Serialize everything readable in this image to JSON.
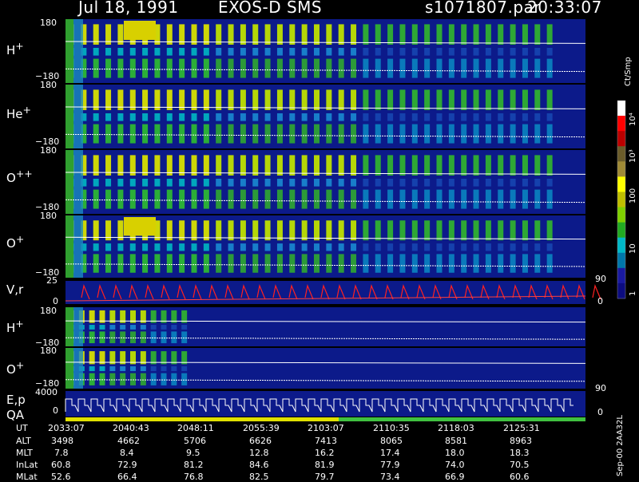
{
  "header": {
    "date": "Jul 18, 1991",
    "title": "EXOS-D SMS",
    "file": "s1071807.par",
    "time": "20:33:07"
  },
  "colorbar": {
    "unit": "Ct/Smp",
    "ticks": [
      "10⁴",
      "10³",
      "100",
      "10",
      "1"
    ],
    "stops": [
      "#ffffff",
      "#ff0000",
      "#bb0000",
      "#6b5c2a",
      "#a08a36",
      "#ffff00",
      "#bfbf00",
      "#7fd000",
      "#22aa22",
      "#00b8c8",
      "#0077aa",
      "#1a1aa0",
      "#0c0c80"
    ]
  },
  "chart_data": {
    "type": "heatmap",
    "panels": [
      {
        "id": "h",
        "label": "H",
        "sup": "+",
        "ymax": "180",
        "ymin": "−180"
      },
      {
        "id": "he",
        "label": "He",
        "sup": "+",
        "ymax": "180",
        "ymin": "−180"
      },
      {
        "id": "opp",
        "label": "O",
        "sup": "++",
        "ymax": "180",
        "ymin": "−180"
      },
      {
        "id": "o",
        "label": "O",
        "sup": "+",
        "ymax": "180",
        "ymin": "−180"
      },
      {
        "id": "vr",
        "label": "V,r",
        "ymax": "25",
        "ymin": "0",
        "right_max": "90",
        "right_min": "0"
      },
      {
        "id": "h2",
        "label": "H",
        "sup": "+",
        "ymax": "180",
        "ymin": "−180"
      },
      {
        "id": "o2",
        "label": "O",
        "sup": "+",
        "ymax": "180",
        "ymin": "−180"
      },
      {
        "id": "ep",
        "label": "E,p",
        "ymax": "4000",
        "ymin": "0",
        "right_max": "90",
        "right_min": "0"
      }
    ],
    "qa_label": "QA",
    "stamp": "Sep-00 2AA32L",
    "ephemeris": {
      "rows": [
        {
          "label": "UT",
          "values": [
            "2033:07",
            "2040:43",
            "2048:11",
            "2055:39",
            "2103:07",
            "2110:35",
            "2118:03",
            "2125:31"
          ]
        },
        {
          "label": "ALT",
          "values": [
            "3498",
            "4662",
            "5706",
            "6626",
            "7413",
            "8065",
            "8581",
            "8963"
          ]
        },
        {
          "label": "MLT",
          "values": [
            "7.8",
            "8.4",
            "9.5",
            "12.8",
            "16.2",
            "17.4",
            "18.0",
            "18.3"
          ]
        },
        {
          "label": "InLat",
          "values": [
            "60.8",
            "72.9",
            "81.2",
            "84.6",
            "81.9",
            "77.9",
            "74.0",
            "70.5"
          ]
        },
        {
          "label": "MLat",
          "values": [
            "52.6",
            "66.4",
            "76.8",
            "82.5",
            "79.7",
            "73.4",
            "66.9",
            "60.6"
          ]
        }
      ]
    }
  }
}
